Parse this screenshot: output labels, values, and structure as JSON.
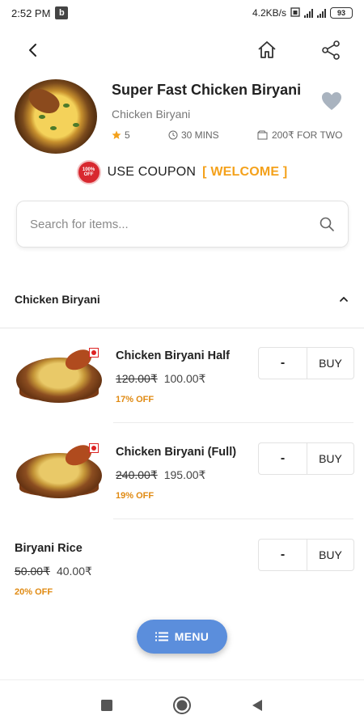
{
  "status_bar": {
    "time": "2:52 PM",
    "notif_badge": "b",
    "net_speed": "4.2KB/s",
    "battery": "93"
  },
  "restaurant": {
    "name": "Super Fast Chicken Biryani",
    "category": "Chicken Biryani",
    "rating": "5",
    "time": "30 MINS",
    "cost_for_two": "200₹ FOR TWO"
  },
  "coupon": {
    "badge_text": "100% OFF",
    "label": "USE COUPON",
    "code": "[ WELCOME ]"
  },
  "search": {
    "placeholder": "Search for items..."
  },
  "section": {
    "title": "Chicken Biryani"
  },
  "items": [
    {
      "name": "Chicken Biryani Half",
      "old_price": "120.00₹",
      "new_price": "100.00₹",
      "discount": "17% OFF",
      "minus": "-",
      "buy": "BUY"
    },
    {
      "name": "Chicken Biryani (Full)",
      "old_price": "240.00₹",
      "new_price": "195.00₹",
      "discount": "19% OFF",
      "minus": "-",
      "buy": "BUY"
    },
    {
      "name": "Biryani Rice",
      "old_price": "50.00₹",
      "new_price": "40.00₹",
      "discount": "20% OFF",
      "minus": "-",
      "buy": "BUY"
    }
  ],
  "menu_button": {
    "label": "MENU"
  },
  "colors": {
    "accent_orange": "#f4a11b",
    "discount": "#e08a12",
    "fab_blue": "#5b8edc",
    "coupon_red": "#d8282f"
  }
}
